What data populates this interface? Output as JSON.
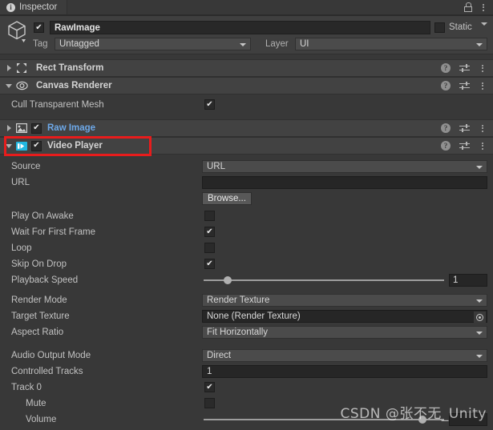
{
  "window": {
    "tab_label": "Inspector",
    "tab_icon": "info-icon",
    "lock_icon": "lock-icon",
    "menu_icon": "kebab-menu-icon"
  },
  "gameobject": {
    "icon": "cube-icon",
    "enabled": true,
    "name": "RawImage",
    "static_checked": false,
    "static_label": "Static",
    "tag_label": "Tag",
    "tag_value": "Untagged",
    "layer_label": "Layer",
    "layer_value": "UI"
  },
  "components": [
    {
      "name": "Rect Transform",
      "icon": "rect-transform-icon",
      "expanded": false,
      "has_enable_checkbox": false,
      "enabled": false,
      "title_color": "#d4d4d4"
    },
    {
      "name": "Canvas Renderer",
      "icon": "eye-icon",
      "expanded": true,
      "has_enable_checkbox": false,
      "enabled": false,
      "title_color": "#d4d4d4"
    },
    {
      "name": "Raw Image",
      "icon": "image-icon",
      "expanded": false,
      "has_enable_checkbox": true,
      "enabled": true,
      "title_color": "#6da8e8"
    },
    {
      "name": "Video Player",
      "icon": "video-player-icon",
      "expanded": true,
      "has_enable_checkbox": true,
      "enabled": true,
      "title_color": "#d4d4d4",
      "highlighted": true
    }
  ],
  "canvas_renderer": {
    "cull_transparent_mesh_label": "Cull Transparent Mesh",
    "cull_transparent_mesh_checked": true
  },
  "video_player": {
    "source_label": "Source",
    "source_value": "URL",
    "url_label": "URL",
    "url_value": "",
    "browse_label": "Browse...",
    "play_on_awake_label": "Play On Awake",
    "play_on_awake_checked": false,
    "wait_for_first_frame_label": "Wait For First Frame",
    "wait_for_first_frame_checked": true,
    "loop_label": "Loop",
    "loop_checked": false,
    "skip_on_drop_label": "Skip On Drop",
    "skip_on_drop_checked": true,
    "playback_speed_label": "Playback Speed",
    "playback_speed_value": "1",
    "playback_speed_pct": 10,
    "render_mode_label": "Render Mode",
    "render_mode_value": "Render Texture",
    "target_texture_label": "Target Texture",
    "target_texture_value": "None (Render Texture)",
    "aspect_ratio_label": "Aspect Ratio",
    "aspect_ratio_value": "Fit Horizontally",
    "audio_output_mode_label": "Audio Output Mode",
    "audio_output_mode_value": "Direct",
    "controlled_tracks_label": "Controlled Tracks",
    "controlled_tracks_value": "1",
    "track0_label": "Track 0",
    "track0_checked": true,
    "mute_label": "Mute",
    "mute_checked": false,
    "volume_label": "Volume",
    "volume_pct": 91
  },
  "annotation": {
    "highlight_color": "#e81c1c",
    "target": "Video Player"
  },
  "watermark": {
    "text": "CSDN @张不无_Unity"
  }
}
